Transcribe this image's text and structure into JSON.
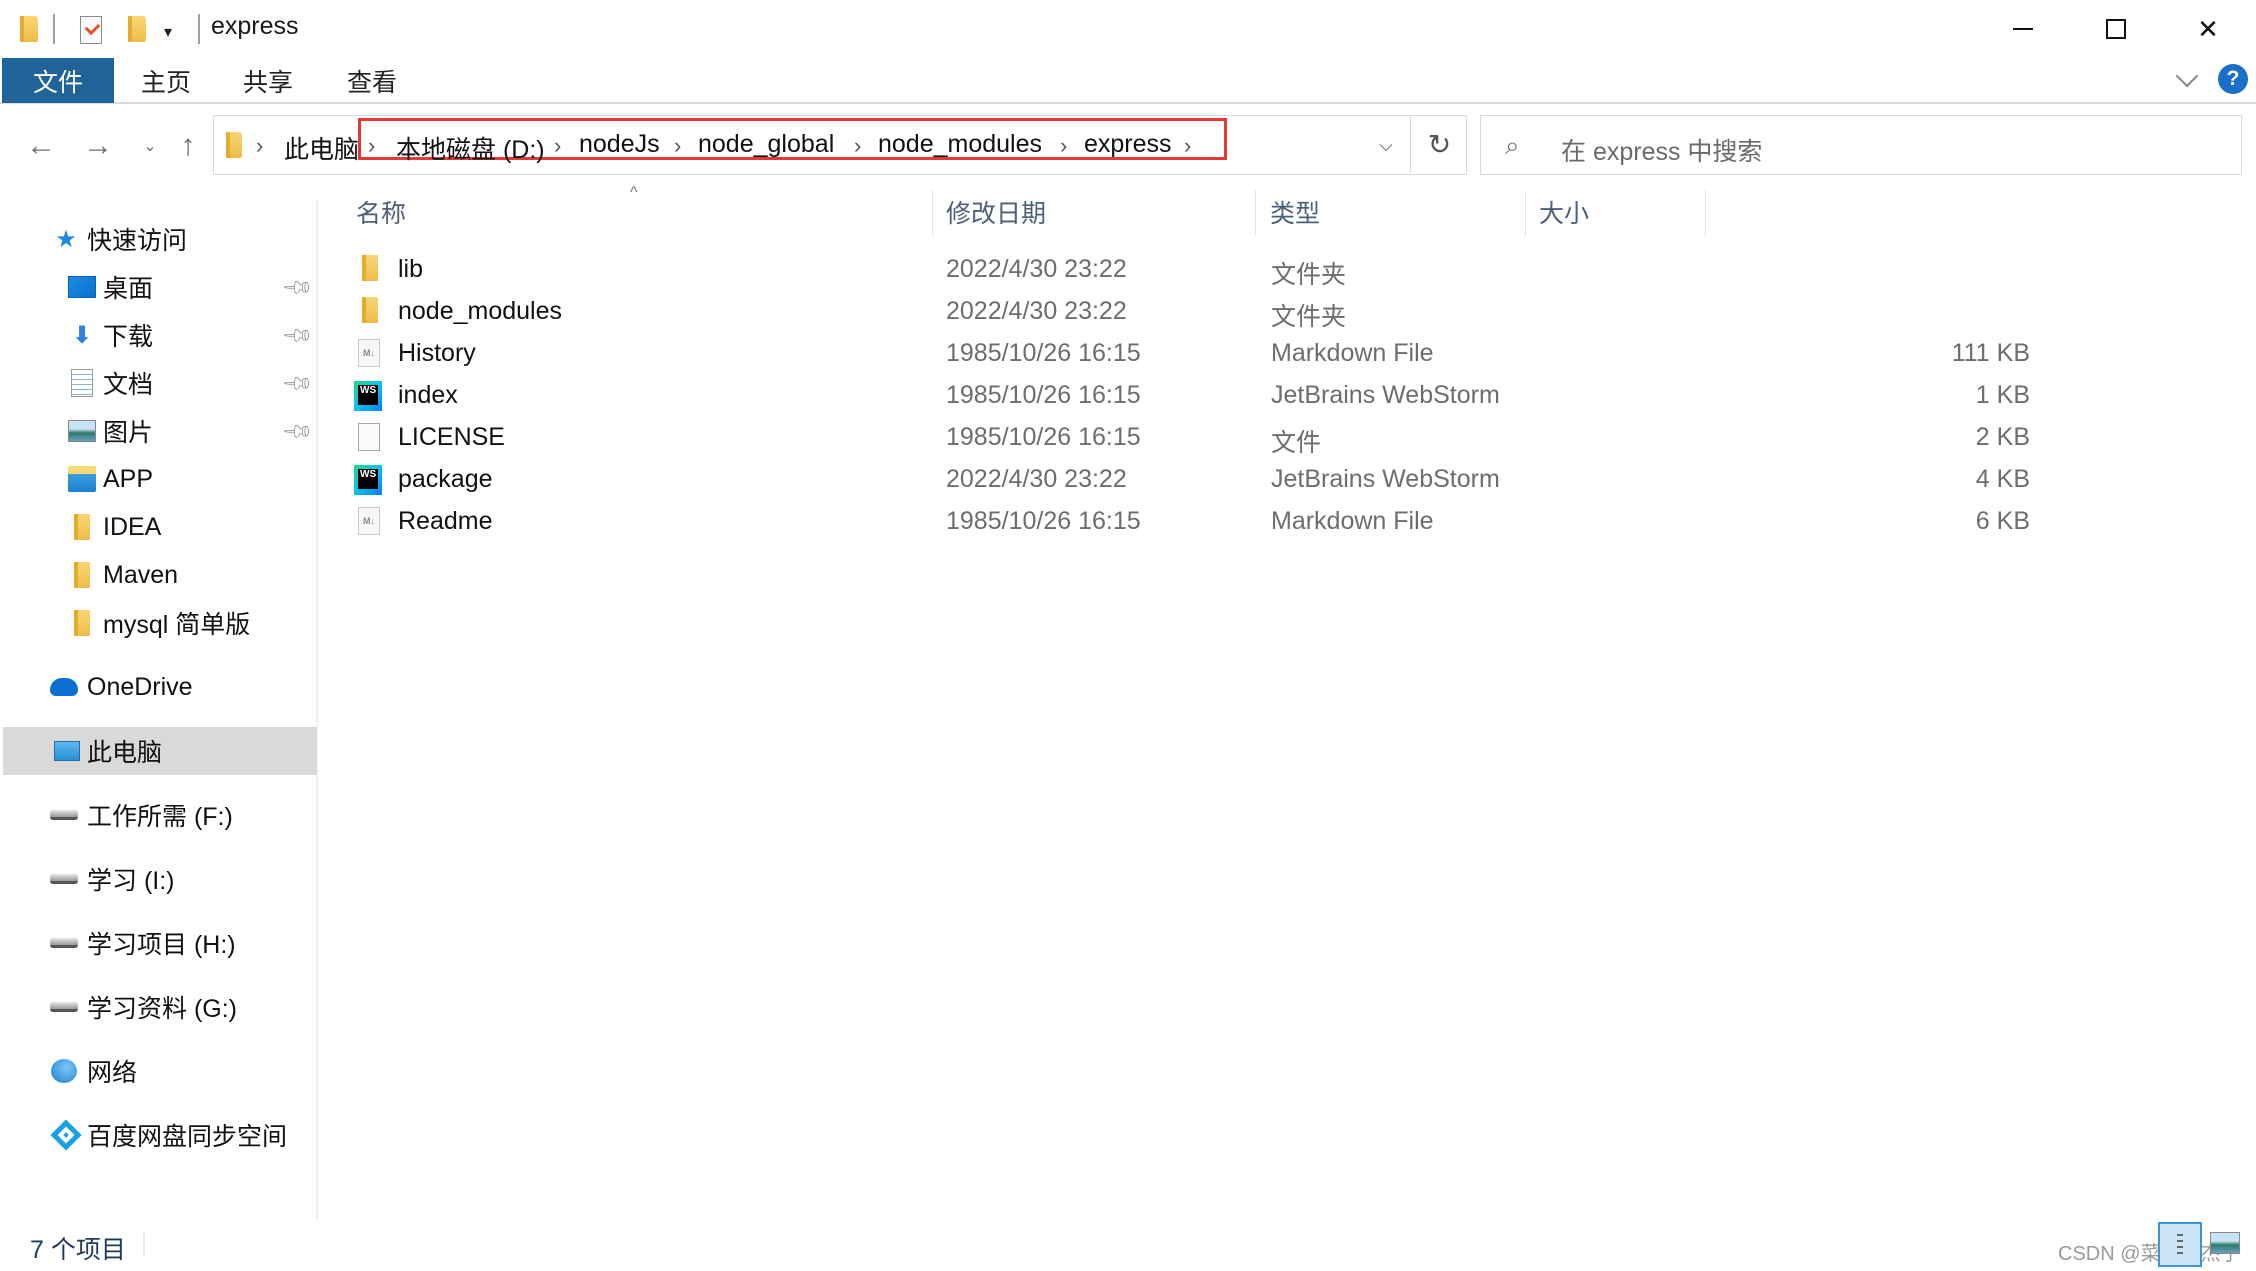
{
  "window": {
    "title": "express",
    "quick_access_toolbar": [
      "folder-icon",
      "properties-icon",
      "new-folder-icon",
      "customize-dropdown-icon"
    ],
    "controls": {
      "minimize": "minimize-icon",
      "maximize": "maximize-icon",
      "close": "close-icon"
    }
  },
  "ribbon": {
    "tabs": [
      {
        "label": "文件",
        "active": true
      },
      {
        "label": "主页"
      },
      {
        "label": "共享"
      },
      {
        "label": "查看"
      }
    ],
    "help_label": "?",
    "accent_color": "#1f6399"
  },
  "nav": {
    "back": "←",
    "forward": "→",
    "recent": "⌄",
    "up": "↑",
    "refresh": "↻",
    "history_dropdown": "⌄"
  },
  "address": {
    "breadcrumbs": [
      "此电脑",
      "本地磁盘 (D:)",
      "nodeJs",
      "node_global",
      "node_modules",
      "express"
    ],
    "highlight_color": "#e53935"
  },
  "search": {
    "placeholder": "在 express 中搜索",
    "icon": "⚲"
  },
  "sidebar": {
    "quick_access": {
      "label": "快速访问"
    },
    "pinned": [
      {
        "label": "桌面",
        "icon": "desktop-icon",
        "pinned": true
      },
      {
        "label": "下载",
        "icon": "download-icon",
        "pinned": true
      },
      {
        "label": "文档",
        "icon": "documents-icon",
        "pinned": true
      },
      {
        "label": "图片",
        "icon": "pictures-icon",
        "pinned": true
      },
      {
        "label": "APP",
        "icon": "network-folder-icon",
        "pinned": false
      },
      {
        "label": "IDEA",
        "icon": "folder-icon",
        "pinned": false
      },
      {
        "label": "Maven",
        "icon": "folder-icon",
        "pinned": false
      },
      {
        "label": "mysql 简单版",
        "icon": "folder-icon",
        "pinned": false
      }
    ],
    "onedrive": {
      "label": "OneDrive"
    },
    "this_pc": {
      "label": "此电脑",
      "selected": true
    },
    "drives": [
      {
        "label": "工作所需 (F:)"
      },
      {
        "label": "学习 (I:)"
      },
      {
        "label": "学习项目 (H:)"
      },
      {
        "label": "学习资料 (G:)"
      }
    ],
    "network": {
      "label": "网络"
    },
    "baidu": {
      "label": "百度网盘同步空间"
    }
  },
  "filelist": {
    "columns": {
      "name": "名称",
      "date": "修改日期",
      "type": "类型",
      "size": "大小"
    },
    "sort_indicator": "^",
    "rows": [
      {
        "name": "lib",
        "date": "2022/4/30 23:22",
        "type": "文件夹",
        "size": "",
        "icon": "folder"
      },
      {
        "name": "node_modules",
        "date": "2022/4/30 23:22",
        "type": "文件夹",
        "size": "",
        "icon": "folder"
      },
      {
        "name": "History",
        "date": "1985/10/26 16:15",
        "type": "Markdown File",
        "size": "111 KB",
        "icon": "markdown"
      },
      {
        "name": "index",
        "date": "1985/10/26 16:15",
        "type": "JetBrains WebStorm",
        "size": "1 KB",
        "icon": "webstorm"
      },
      {
        "name": "LICENSE",
        "date": "1985/10/26 16:15",
        "type": "文件",
        "size": "2 KB",
        "icon": "blank"
      },
      {
        "name": "package",
        "date": "2022/4/30 23:22",
        "type": "JetBrains WebStorm",
        "size": "4 KB",
        "icon": "webstorm"
      },
      {
        "name": "Readme",
        "date": "1985/10/26 16:15",
        "type": "Markdown File",
        "size": "6 KB",
        "icon": "markdown"
      }
    ]
  },
  "statusbar": {
    "item_count": "7 个项目",
    "watermark": "CSDN @菜鸟汴杰子"
  }
}
